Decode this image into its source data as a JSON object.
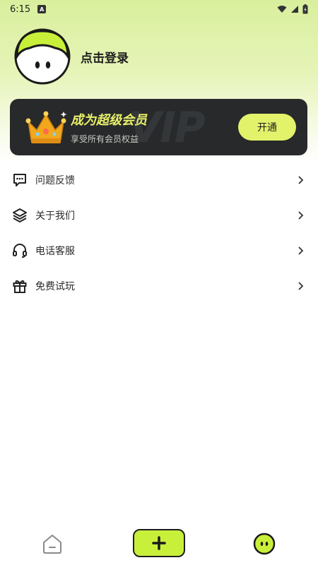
{
  "status_bar": {
    "time": "6:15",
    "notification_badge": "A",
    "icons": [
      "wifi-icon",
      "signal-icon",
      "battery-icon"
    ]
  },
  "profile": {
    "login_label": "点击登录",
    "avatar_icon": "mushroom-face-avatar"
  },
  "vip": {
    "title": "成为超级会员",
    "subtitle": "享受所有会员权益",
    "watermark": "VIP",
    "button_label": "开通",
    "icon": "crown-icon"
  },
  "menu": {
    "items": [
      {
        "label": "问题反馈",
        "icon": "feedback-icon"
      },
      {
        "label": "关于我们",
        "icon": "layers-icon"
      },
      {
        "label": "电话客服",
        "icon": "headset-icon"
      },
      {
        "label": "免费试玩",
        "icon": "gift-icon"
      }
    ]
  },
  "bottom_nav": {
    "items": [
      "home-icon",
      "add-icon",
      "me-face-icon"
    ]
  },
  "colors": {
    "accent": "#c8f03a",
    "vip_card_bg": "#27292a",
    "vip_title": "#e8f06a",
    "button_bg": "#e3f26b"
  }
}
